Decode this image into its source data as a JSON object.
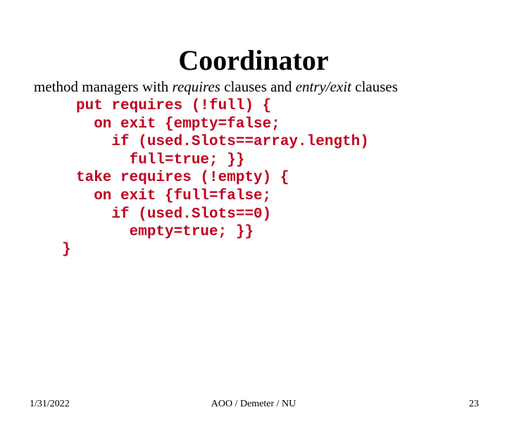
{
  "title": "Coordinator",
  "subtitle": {
    "pre": "method managers with ",
    "it1": "requires",
    "mid": " clauses and ",
    "it2": "entry/exit",
    "post": " clauses"
  },
  "code": {
    "l1": "put requires (!full) {",
    "l2": "  on exit {empty=false;",
    "l3": "    if (used.Slots==array.length)",
    "l4": "      full=true; }}",
    "l5": "take requires (!empty) {",
    "l6": "  on exit {full=false;",
    "l7": "    if (used.Slots==0)",
    "l8": "      empty=true; }}",
    "close": "}"
  },
  "footer": {
    "date": "1/31/2022",
    "center": "AOO / Demeter / NU",
    "page": "23"
  }
}
